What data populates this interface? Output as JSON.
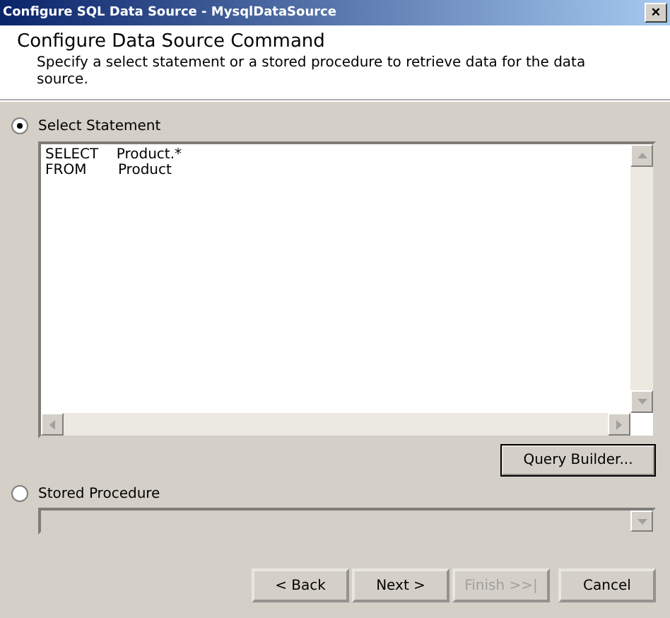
{
  "window": {
    "title": "Configure SQL Data Source - MysqlDataSource",
    "close": "×"
  },
  "header": {
    "title": "Configure Data Source Command",
    "description": "Specify a select statement or a stored procedure to retrieve data for the data source."
  },
  "options": [
    {
      "label": "Select Statement",
      "selected": true
    },
    {
      "label": "Stored Procedure",
      "selected": false
    }
  ],
  "statement": {
    "lines": [
      "SELECT    Product.*",
      "FROM       Product"
    ]
  },
  "query_builder": {
    "label": "Query Builder...",
    "default": true
  },
  "buttons": [
    {
      "label": "< Back",
      "disabled": false
    },
    {
      "label": "Next >",
      "disabled": false
    },
    {
      "label": "Finish >>|",
      "disabled": true
    },
    {
      "label": "Cancel",
      "disabled": false
    }
  ]
}
